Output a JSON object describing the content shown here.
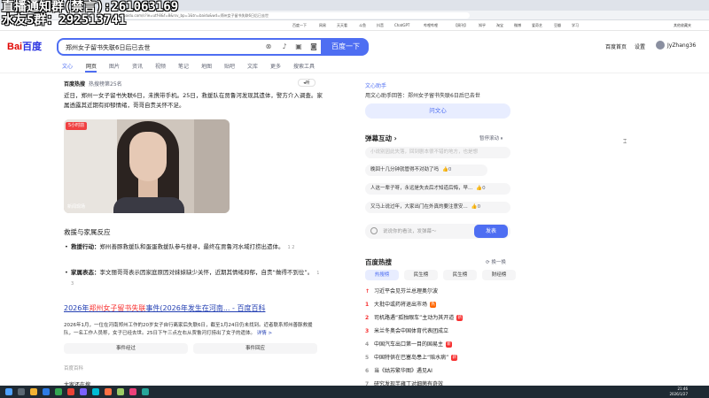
{
  "overlay": {
    "line1": "直播通知群(禁言):261063169",
    "line2": "水友5群：292513741"
  },
  "browser": {
    "url": "https://www.baidu.com/s?ie=utf-8&f=8&rsv_bp=1&tn=baidu&wd=郑州女子留书失联6日后已去世",
    "bookmarks": [
      "百度一下",
      "网易",
      "天天看",
      "斗鱼",
      "抖音",
      "ChatGPT",
      "哔哩哔哩",
      "【周刊】",
      "知乎",
      "淘宝",
      "微博",
      "爱奇艺",
      "豆瓣",
      "学习",
      "其他收藏夹"
    ]
  },
  "header": {
    "logo_bai": "Bai",
    "logo_du": "百度",
    "query": "郑州女子留书失联6日后已去世",
    "search_button": "百度一下",
    "baidu_home": "百度首页",
    "settings": "设置",
    "username": "JyZhang36"
  },
  "nav": {
    "tabs": [
      "文心",
      "网页",
      "图片",
      "资讯",
      "视频",
      "笔记",
      "地图",
      "贴吧",
      "文库",
      "更多",
      "搜索工具"
    ]
  },
  "result": {
    "hot_label": "百度热搜",
    "hot_rank": "热搜榜第25名",
    "listen": "听",
    "summary": "近日，郑州一女子留书失联6日，未携带手机。25日，救援队在贾鲁河发现其遗体，警方介入调查。家属透露其近期有抑郁情绪，哥哥自责关怀不足。",
    "video_badge": "5小时前",
    "video_caption": "新闻现场",
    "section_title": "救援与家属反应",
    "bullets": [
      {
        "label": "救援行动：",
        "text": "郑州善豚救援队和蛋蛋救援队参与搜寻，最终在贾鲁河水域打捞出遗体。",
        "ref": "1  2"
      },
      {
        "label": "家属表态：",
        "text": "李文丽哥哥表示因家庭原因对妹妹缺少关怀，近期其情绪抑郁，自责“做得不到位”。",
        "ref": "1  3"
      }
    ],
    "baike_title_pre": "2026年",
    "baike_title_red": "郑州女子留书失联",
    "baike_title_post": "事件(2026年发生在河南... - 百度百科",
    "baike_text": "2026年1月，一位在河南郑州工作的20岁女子自行离家后失联6日，截至1月24日仍未找到。近者联系郑州善豚救援队，一名工作人员称，女子已经去世。25日下午三点左右从贾鲁河打捞出了女子的遗体。",
    "baike_more": "详情 >",
    "baike_btn1": "事件经过",
    "baike_btn2": "事件回应",
    "baike_source": "百度百科",
    "cutoff": "大家还在搜"
  },
  "ai": {
    "title": "文心助手",
    "question": "用文心助手回答：郑州女子留书失联6日后已去世",
    "button": "问文心"
  },
  "danmu": {
    "title": "弹幕互动",
    "pause": "暂停滚动",
    "comments": [
      {
        "text": "小说别因此失落，回到剧本很不错的地方，也是想",
        "likes": "0",
        "faded": true
      },
      {
        "text": "晚回十几分钟就管得不对劲了吗",
        "likes": "0",
        "faded": false
      },
      {
        "text": "人这一辈子呀，永远是失去后才知道后悔，早...",
        "likes": "0",
        "faded": false
      },
      {
        "text": "又马上说过年，大家出门在外真的要注意安...",
        "likes": "0",
        "faded": false
      }
    ],
    "placeholder": "说说你的看法，发弹幕～",
    "send": "发表"
  },
  "hot": {
    "title": "百度热搜",
    "refresh": "换一换",
    "tabs": [
      "热搜榜",
      "民生榜",
      "民生榜",
      "财经榜"
    ],
    "items": [
      {
        "num": "↑",
        "text": "习近平会见芬兰总理奥尔波",
        "tag": ""
      },
      {
        "num": "1",
        "text": "大批中或药将退出市场",
        "tag": "hot"
      },
      {
        "num": "2",
        "text": "司机路遇“孤独眼车”主动为其开道",
        "tag": "new"
      },
      {
        "num": "3",
        "text": "米兰冬奥会中国体育代表团成立",
        "tag": ""
      },
      {
        "num": "4",
        "text": "中国汽车出口第一目的国易主",
        "tag": "new"
      },
      {
        "num": "5",
        "text": "中国特供在巴塞岛患上“赔水病”",
        "tag": "new"
      },
      {
        "num": "6",
        "text": "当《姑苏繁华图》遇见AI",
        "tag": ""
      },
      {
        "num": "7",
        "text": "研究发现芊雍丁对细菌有奇效",
        "tag": ""
      }
    ]
  },
  "taskbar": {
    "time": "21:46",
    "date": "2026/1/27"
  }
}
